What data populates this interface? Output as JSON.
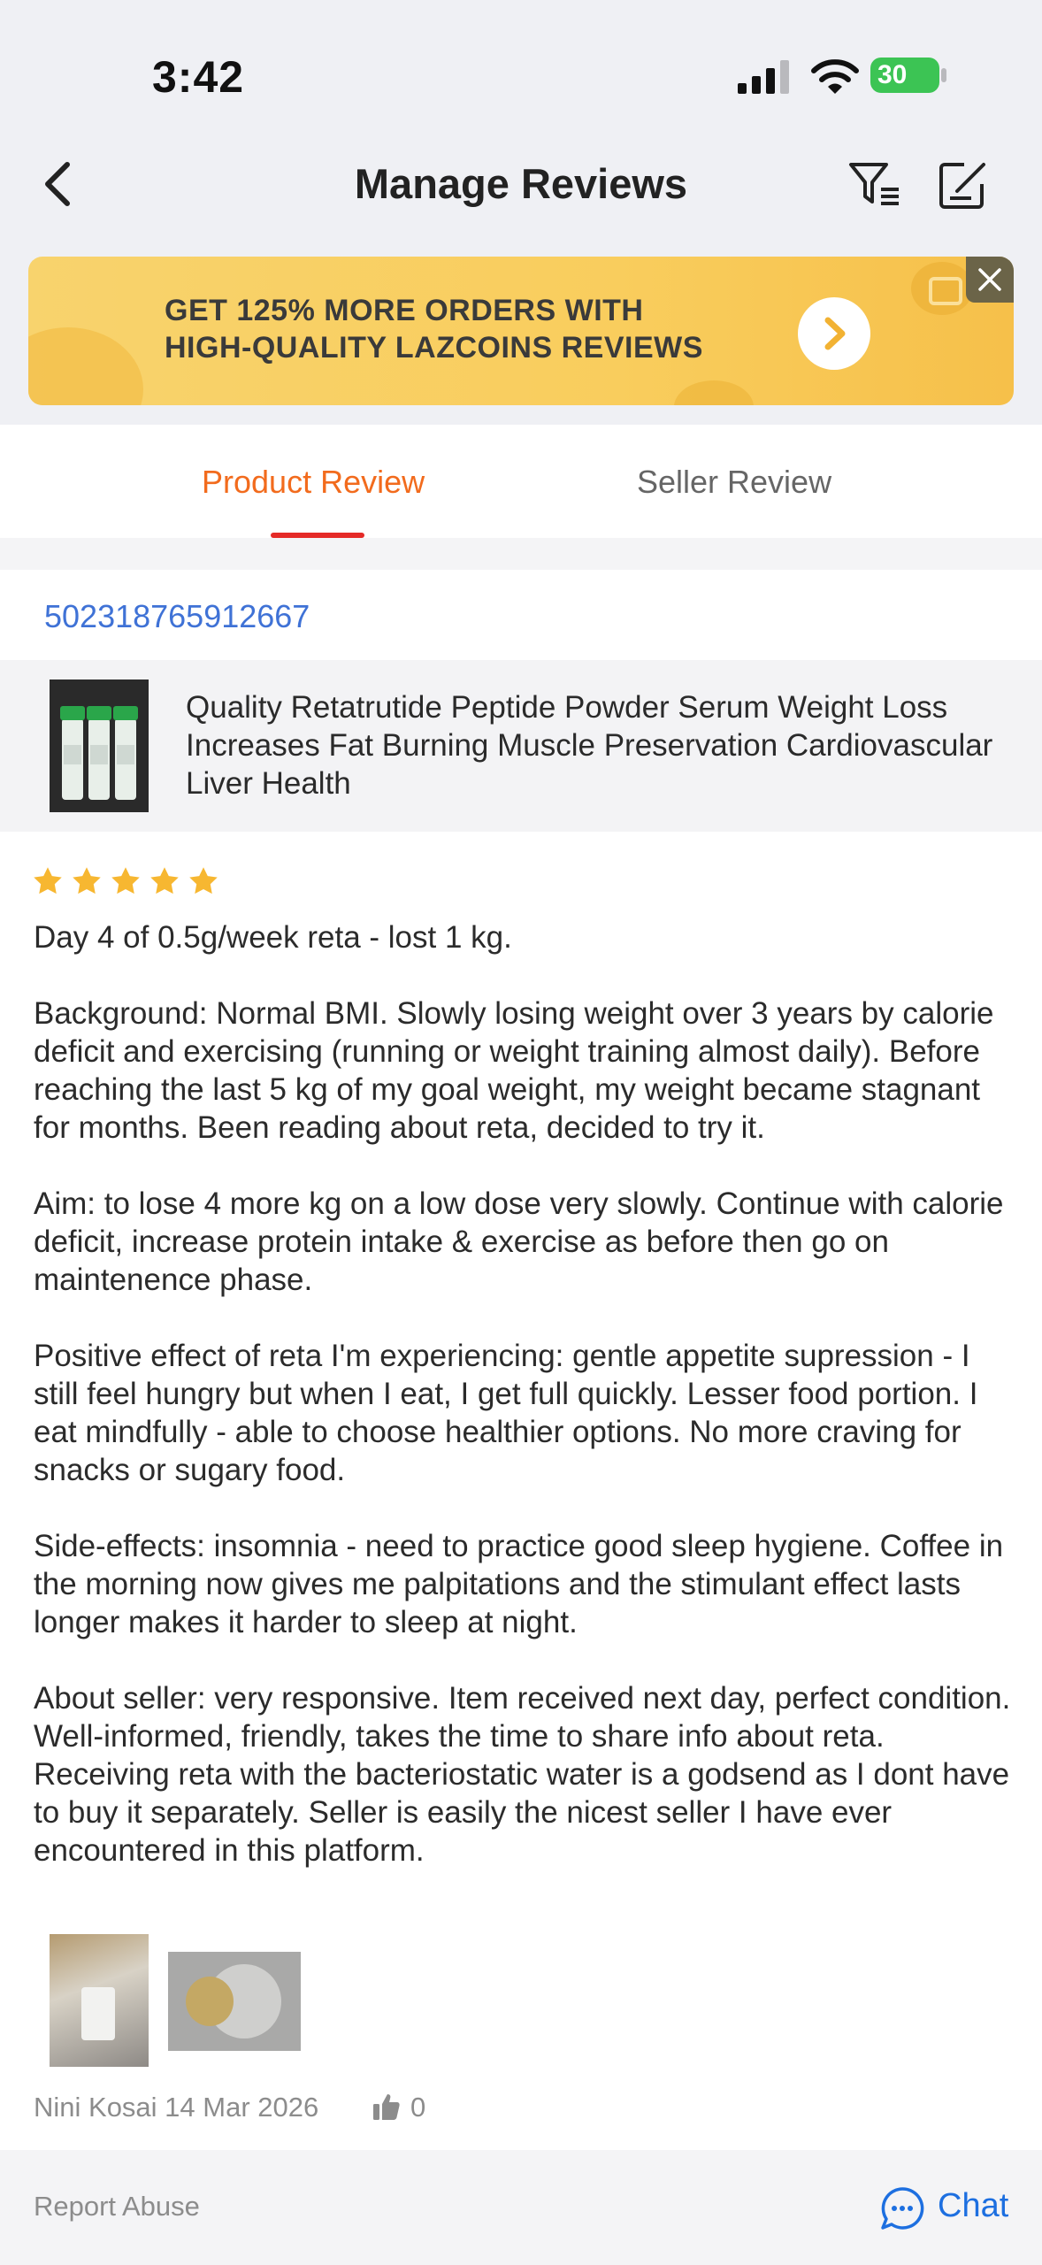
{
  "status_bar": {
    "time": "3:42",
    "battery": "30"
  },
  "header": {
    "title": "Manage Reviews"
  },
  "banner": {
    "line1": "GET 125% MORE ORDERS WITH",
    "line2": "HIGH-QUALITY LAZCOINS REVIEWS"
  },
  "tabs": {
    "product": "Product Review",
    "seller": "Seller Review"
  },
  "order": {
    "id": "502318765912667",
    "product_name": "Quality Retatrutide Peptide Powder Serum Weight Loss Increases Fat Burning Muscle Preservation Cardiovascular Liver Health"
  },
  "review": {
    "rating": 5,
    "paragraphs": [
      "Day 4 of 0.5g/week reta - lost 1 kg.",
      "Background: Normal BMI. Slowly losing weight over 3 years by calorie deficit and exercising (running or weight training almost daily). Before reaching the last 5 kg of my goal weight, my weight became stagnant for months. Been reading about reta, decided to try it.",
      "Aim: to lose 4 more kg on a low dose very slowly. Continue with calorie deficit, increase protein intake & exercise as before then go on maintenence phase.",
      "Positive effect of reta I'm experiencing: gentle appetite supression - I still feel hungry but when I eat,  I get full quickly. Lesser food portion. I eat mindfully - able to choose healthier options. No more craving for snacks or sugary food.",
      "Side-effects: insomnia - need to practice good sleep hygiene. Coffee in the morning now gives me palpitations and the stimulant effect lasts longer makes it harder to sleep at night.",
      "About seller: very responsive. Item received next day, perfect condition. Well-informed, friendly, takes the time to share info about reta. Receiving reta with the bacteriostatic water is a godsend as I dont have to buy it separately. Seller is easily the nicest seller I have ever encountered in this platform."
    ],
    "author_date": "Nini Kosai 14 Mar 2026",
    "likes": "0"
  },
  "footer": {
    "report": "Report Abuse",
    "chat": "Chat"
  },
  "colors": {
    "accent_orange": "#f26b1d",
    "tab_underline": "#e52a27",
    "link_blue": "#3f72d6",
    "chat_blue": "#1d6fe0",
    "star": "#f7b731",
    "banner": "#f8d36d"
  }
}
